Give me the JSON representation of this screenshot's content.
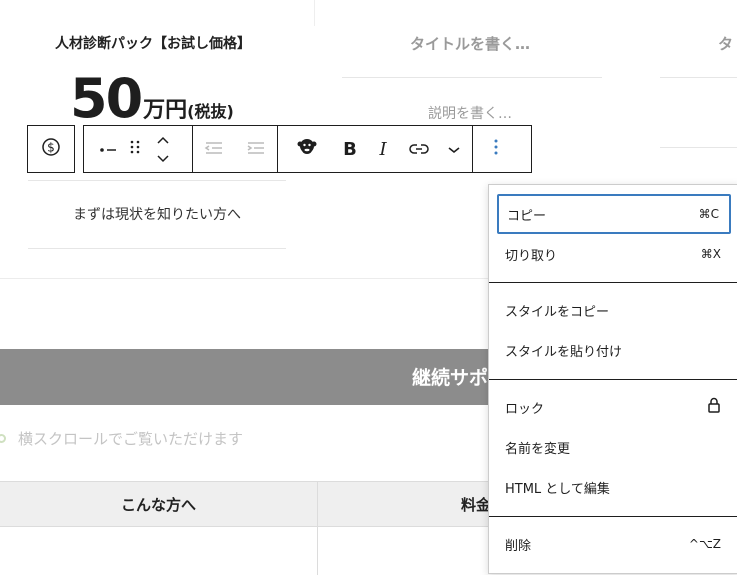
{
  "card": {
    "title": "人材診断パック【お試し価格】",
    "price_number": "50",
    "price_unit": "万円",
    "price_tax": "(税抜)",
    "subtitle": "まずは現状を知りたい方へ"
  },
  "column2": {
    "title_placeholder": "タイトルを書く…",
    "desc_placeholder": "説明を書く…"
  },
  "column3": {
    "title_placeholder": "タ"
  },
  "toolbar": {
    "icons": [
      "dollar-circle-icon",
      "list-icon",
      "drag-handle-icon",
      "move-up-icon",
      "move-down-icon",
      "outdent-icon",
      "indent-icon",
      "gorilla-icon",
      "bold-icon",
      "italic-icon",
      "link-icon",
      "chevron-down-icon",
      "more-options-icon"
    ],
    "bold_label": "B",
    "italic_label": "I"
  },
  "banner": {
    "text": "継続サポ"
  },
  "scroll_hint": "横スクロールでご覧いただけます",
  "table_header": {
    "col1": "こんな方へ",
    "col2": "料金"
  },
  "menu": {
    "copy": "コピー",
    "copy_shortcut": "⌘C",
    "cut": "切り取り",
    "cut_shortcut": "⌘X",
    "copy_style": "スタイルをコピー",
    "paste_style": "スタイルを貼り付け",
    "lock": "ロック",
    "rename": "名前を変更",
    "edit_html": "HTML として編集",
    "delete": "削除",
    "delete_shortcut": "^⌥Z"
  },
  "colors": {
    "banner": "#8c8c8c",
    "focus": "#3a7bbf",
    "placeholder": "#9a9a9a"
  }
}
